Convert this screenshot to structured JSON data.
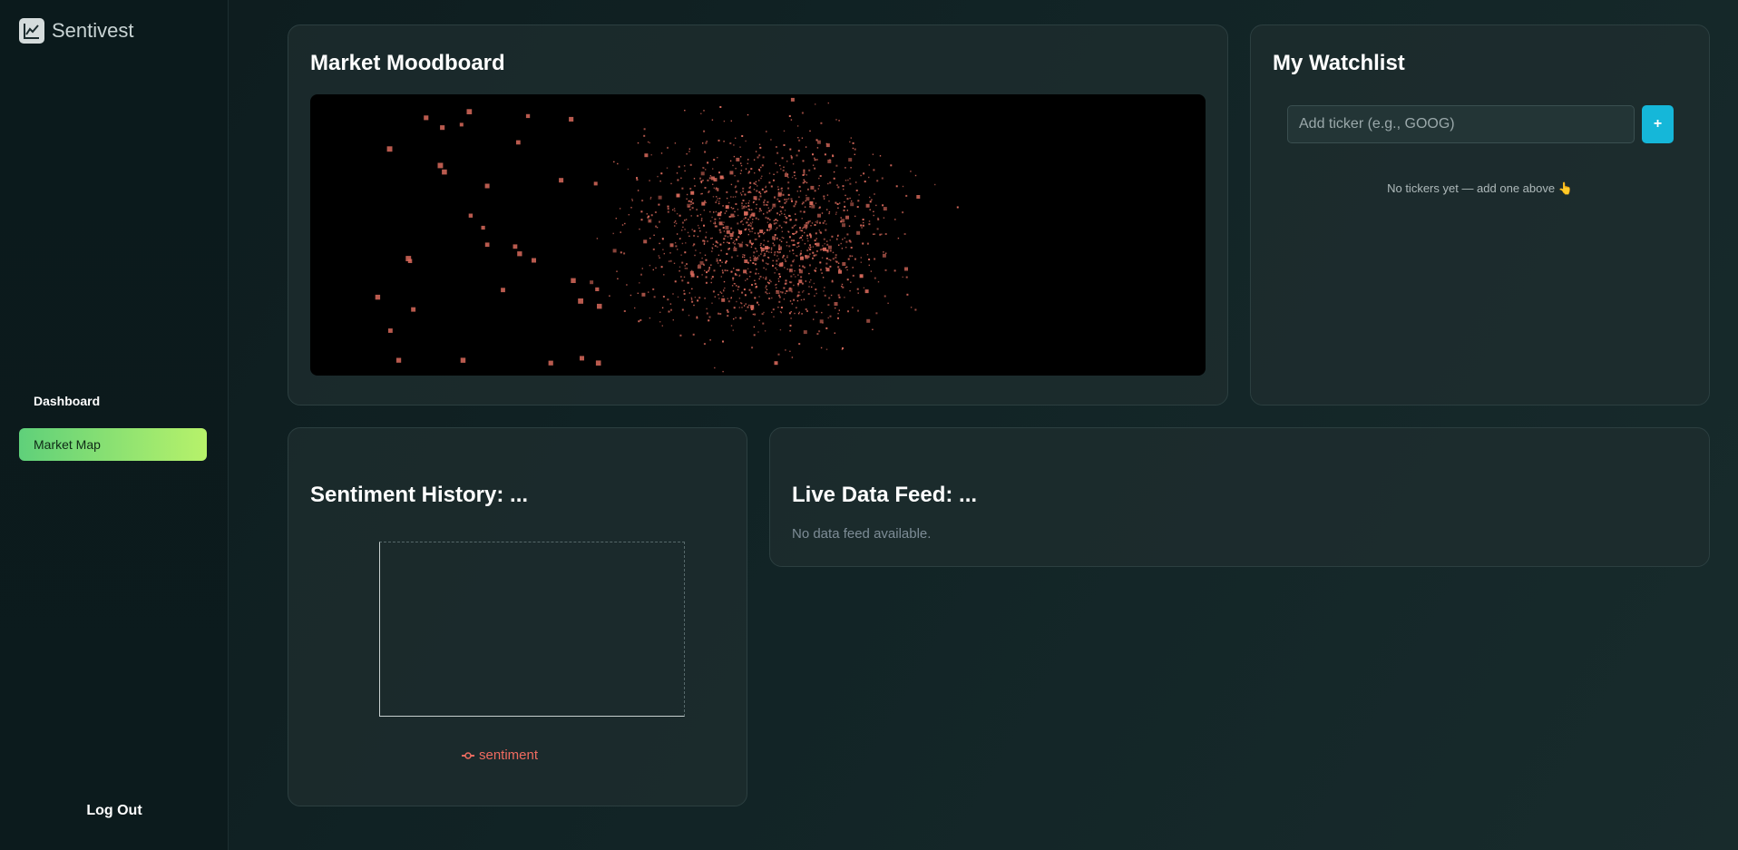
{
  "app": {
    "name": "Sentivest"
  },
  "sidebar": {
    "items": [
      {
        "label": "Dashboard",
        "active": false
      },
      {
        "label": "Market Map",
        "active": true
      }
    ],
    "logout_label": "Log Out"
  },
  "moodboard": {
    "title": "Market Moodboard",
    "dot_color": "#d96a5c"
  },
  "watchlist": {
    "title": "My Watchlist",
    "input_placeholder": "Add ticker (e.g., GOOG)",
    "add_button": "+",
    "empty_text": "No tickers yet — add one above 👆"
  },
  "sentiment_history": {
    "title": "Sentiment History: ...",
    "legend_label": "sentiment"
  },
  "live_feed": {
    "title": "Live Data Feed: ...",
    "empty_text": "No data feed available."
  },
  "colors": {
    "accent_green": "#5fd07a",
    "accent_lime": "#b7f26a",
    "accent_cyan": "#15b7d9",
    "series": "#f06b60"
  }
}
